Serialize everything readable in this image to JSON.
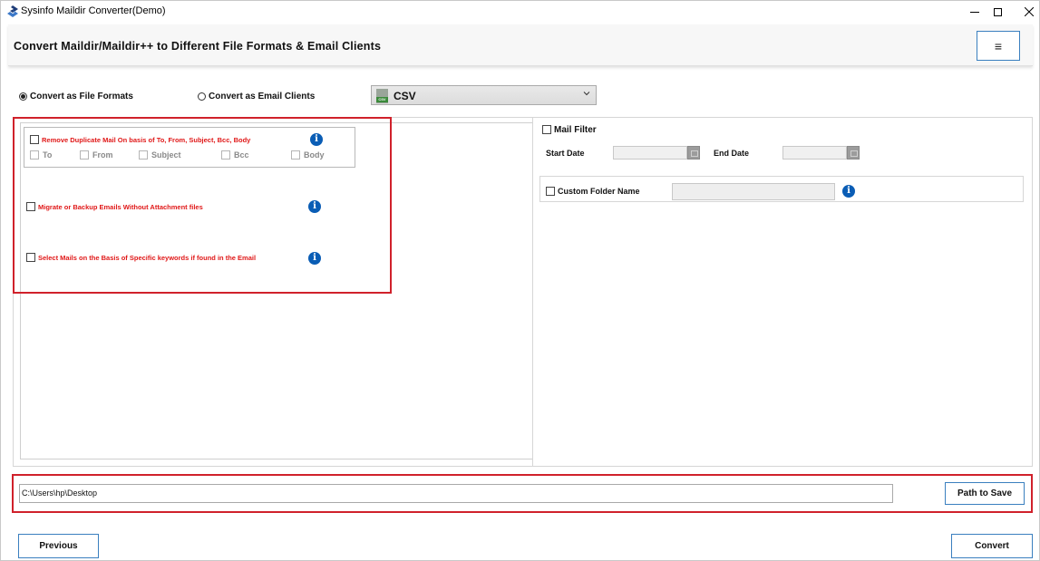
{
  "window": {
    "title": "Sysinfo Maildir Converter(Demo)",
    "icon": "app-logo-icon",
    "controls": [
      "minimize-icon",
      "maximize-icon",
      "close-icon"
    ]
  },
  "header": {
    "title": "Convert Maildir/Maildir++ to Different File Formats & Email Clients",
    "menu_icon": "≡"
  },
  "mode": {
    "file_formats_label": "Convert as File Formats",
    "email_clients_label": "Convert as Email Clients",
    "selected": "file_formats"
  },
  "format_select": {
    "value": "CSV",
    "icon_text": "CSV",
    "icon": "csv-file-icon"
  },
  "options": {
    "remove_duplicate_label": "Remove Duplicate Mail On basis of To, From, Subject, Bcc, Body",
    "duplicate_fields": [
      "To",
      "From",
      "Subject",
      "Bcc",
      "Body"
    ],
    "without_attachment_label": "Migrate or Backup Emails Without Attachment files",
    "keyword_label": "Select Mails on the Basis of Specific keywords if found in the Email",
    "info_glyph": "i"
  },
  "mail_filter": {
    "label": "Mail Filter",
    "start_date_label": "Start Date",
    "end_date_label": "End Date",
    "custom_folder_label": "Custom Folder Name"
  },
  "save": {
    "path_value": "C:\\Users\\hp\\Desktop",
    "path_button_label": "Path to Save"
  },
  "footer": {
    "previous_label": "Previous",
    "convert_label": "Convert"
  },
  "colors": {
    "accent_border": "#3a7fbf",
    "highlight_red": "#d0212b",
    "option_red": "#e01818",
    "info_blue": "#0a5db5"
  }
}
